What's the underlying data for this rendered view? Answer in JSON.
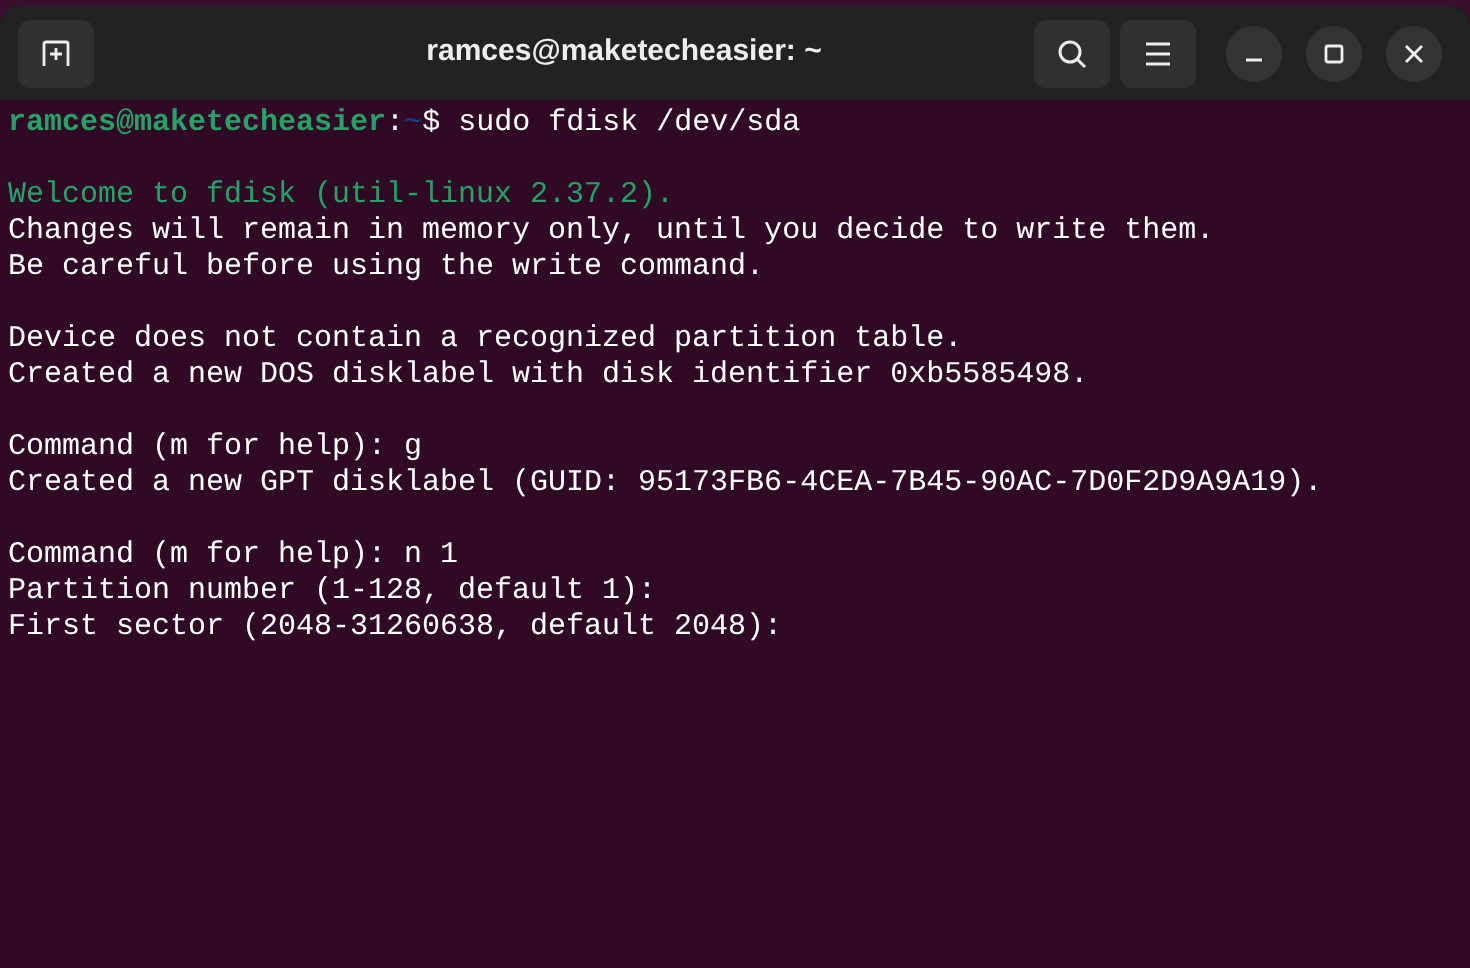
{
  "window": {
    "title": "ramces@maketecheasier: ~"
  },
  "terminal": {
    "blocks": [
      [
        {
          "kind": "prompt",
          "user": "ramces@maketecheasier",
          "separator": ":",
          "path": "~",
          "command": "$ sudo fdisk /dev/sda"
        }
      ],
      [
        {
          "kind": "info",
          "text": "Welcome to fdisk (util-linux 2.37.2)."
        },
        {
          "kind": "output",
          "text": "Changes will remain in memory only, until you decide to write them."
        },
        {
          "kind": "output",
          "text": "Be careful before using the write command."
        }
      ],
      [
        {
          "kind": "output",
          "text": "Device does not contain a recognized partition table."
        },
        {
          "kind": "output",
          "text": "Created a new DOS disklabel with disk identifier 0xb5585498."
        }
      ],
      [
        {
          "kind": "output",
          "text": "Command (m for help): g"
        },
        {
          "kind": "output",
          "text": "Created a new GPT disklabel (GUID: 95173FB6-4CEA-7B45-90AC-7D0F2D9A9A19)."
        }
      ],
      [
        {
          "kind": "output",
          "text": "Command (m for help): n 1"
        },
        {
          "kind": "output",
          "text": "Partition number (1-128, default 1):"
        },
        {
          "kind": "output",
          "text": "First sector (2048-31260638, default 2048):"
        }
      ]
    ]
  }
}
